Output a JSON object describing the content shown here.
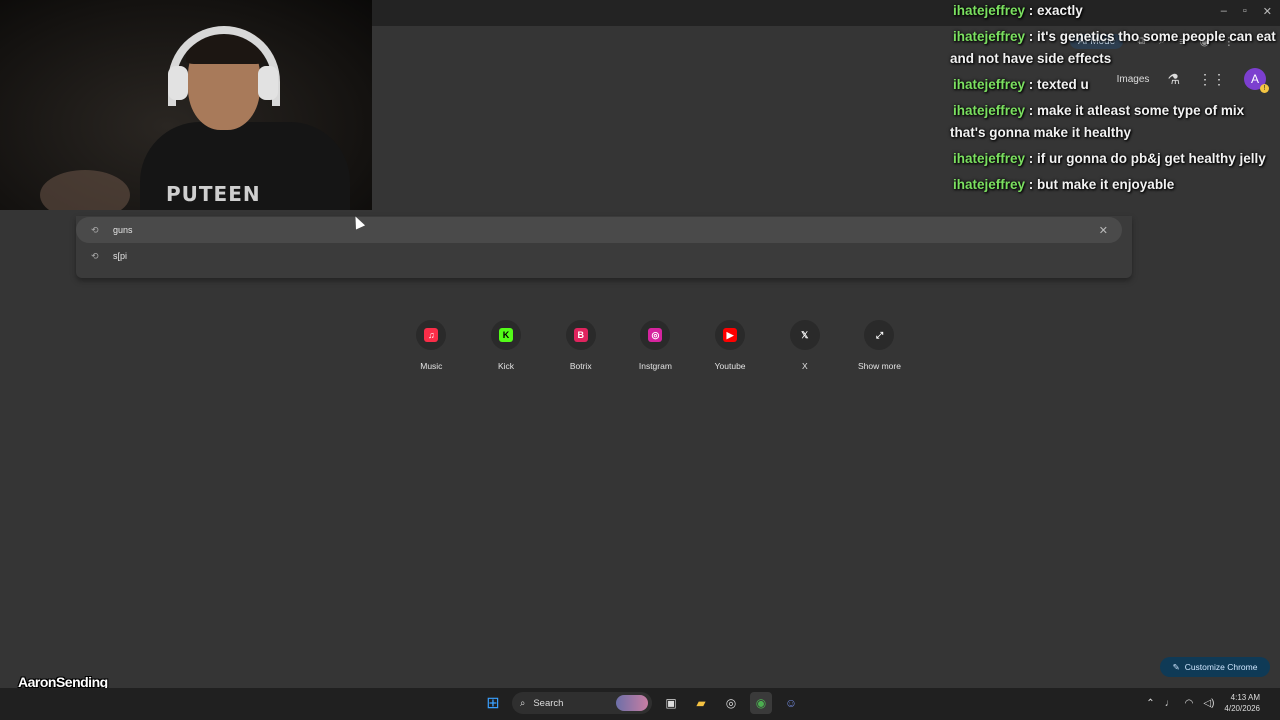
{
  "window_controls": {
    "minimize": "–",
    "maximize": "▫",
    "close": "✕"
  },
  "toolbar": {
    "ai_mode_label": "AI Mode"
  },
  "ntp_header": {
    "images_link": "Images",
    "avatar_letter": "A"
  },
  "chat": [
    {
      "user": "ihatejeffrey",
      "text": "exactly"
    },
    {
      "user": "ihatejeffrey",
      "text": "it's genetics tho some people can eat and not have side effects"
    },
    {
      "user": "ihatejeffrey",
      "text": "texted u"
    },
    {
      "user": "ihatejeffrey",
      "text": "make it atleast some type of mix that's gonna make it healthy"
    },
    {
      "user": "ihatejeffrey",
      "text": "if ur gonna do pb&j get healthy jelly"
    },
    {
      "user": "ihatejeffrey",
      "text": "but make it enjoyable"
    }
  ],
  "webcam": {
    "shirt_text": "PUTEEN"
  },
  "suggestions": [
    {
      "text": "guns",
      "icon": "history-icon"
    },
    {
      "text": "s[pi",
      "icon": "history-icon"
    }
  ],
  "shortcuts": [
    {
      "label": "Music",
      "icon": "music-icon",
      "color": "#fa2d48",
      "glyph": "♫"
    },
    {
      "label": "Kick",
      "icon": "kick-icon",
      "color": "#53fc18",
      "glyph": "K"
    },
    {
      "label": "Botrix",
      "icon": "botrix-icon",
      "color": "#e0245e",
      "glyph": "B"
    },
    {
      "label": "Instgram",
      "icon": "instagram-icon",
      "color": "#d6249f",
      "glyph": "◎"
    },
    {
      "label": "Youtube",
      "icon": "youtube-icon",
      "color": "#ff0000",
      "glyph": "▶"
    },
    {
      "label": "X",
      "icon": "x-icon",
      "color": "#2a2a2a",
      "glyph": "𝕏"
    },
    {
      "label": "Show more",
      "icon": "expand-icon",
      "color": "#2a2a2a",
      "glyph": "⤢"
    }
  ],
  "customize": {
    "label": "Customize Chrome"
  },
  "brand": {
    "name": "AaronSending"
  },
  "taskbar": {
    "search_label": "Search",
    "time": "4:13 AM",
    "date": "4/20/2026"
  }
}
